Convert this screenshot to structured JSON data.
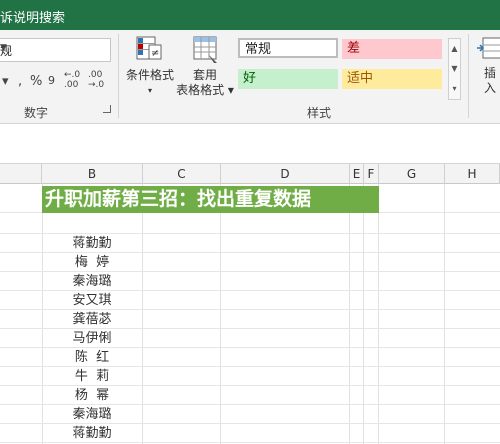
{
  "titlebar": {
    "tellme": "诉说明搜索"
  },
  "ribbon": {
    "number_format": "规",
    "number_buttons": [
      ",",
      "%",
      "9",
      "←.0 .00",
      ".00 →.0"
    ],
    "groups": {
      "number": "数字",
      "styles": "样式"
    },
    "conditional_format": "条件格式",
    "format_table_line1": "套用",
    "format_table_line2": "表格格式",
    "styles": [
      {
        "label": "常规",
        "bg": "#ffffff"
      },
      {
        "label": "差",
        "bg": "#ffc7ce",
        "fg": "#9c0006"
      },
      {
        "label": "好",
        "bg": "#c6efce",
        "fg": "#006100"
      },
      {
        "label": "适中",
        "bg": "#ffeb9c",
        "fg": "#9c5700"
      }
    ],
    "insert": "插入"
  },
  "columns": [
    "B",
    "C",
    "D",
    "E",
    "F",
    "G",
    "H"
  ],
  "banner": "升职加薪第三招：找出重复数据",
  "names": [
    "蒋勤勤",
    "梅  婷",
    "秦海璐",
    "安又琪",
    "龚蓓苾",
    "马伊俐",
    "陈  红",
    "牛  莉",
    "杨  幂",
    "秦海璐",
    "蒋勤勤"
  ],
  "colors": {
    "excel_green": "#217346",
    "banner_green": "#70ad47"
  }
}
